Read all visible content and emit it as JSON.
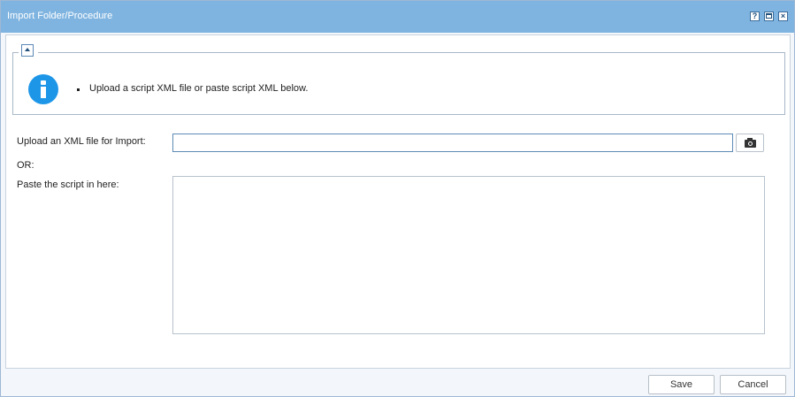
{
  "window": {
    "title": "Import Folder/Procedure",
    "controls": {
      "help": "?",
      "maximize": "",
      "close": "×"
    }
  },
  "info": {
    "message": "Upload a script XML file or paste script XML below."
  },
  "form": {
    "upload_label": "Upload an XML file for Import:",
    "upload_value": "",
    "or_label": "OR:",
    "paste_label": "Paste the script in here:",
    "paste_value": ""
  },
  "footer": {
    "save_label": "Save",
    "cancel_label": "Cancel"
  },
  "colors": {
    "titlebar": "#7fb4e0",
    "info_icon": "#1e96e8"
  },
  "icons": [
    "help-icon",
    "maximize-icon",
    "close-icon",
    "collapse-up-icon",
    "info-icon",
    "camera-icon"
  ]
}
